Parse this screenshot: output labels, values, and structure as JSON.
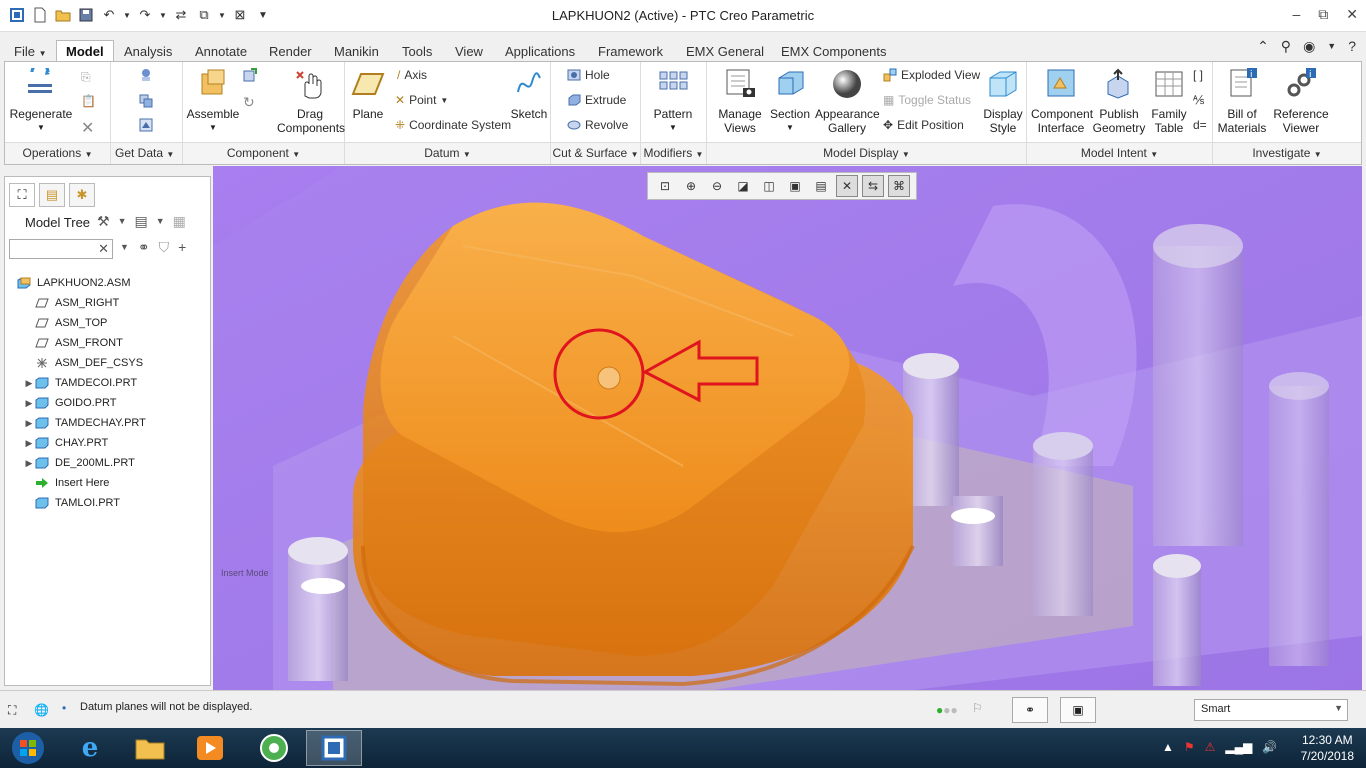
{
  "window": {
    "title": "LAPKHUON2 (Active) - PTC Creo Parametric"
  },
  "tabs": [
    "File",
    "Model",
    "Analysis",
    "Annotate",
    "Render",
    "Manikin",
    "Tools",
    "View",
    "Applications",
    "Framework",
    "EMX General",
    "EMX Components"
  ],
  "ribbon": {
    "regenerate": "Regenerate",
    "assemble": "Assemble",
    "drag_components": "Drag Components",
    "plane": "Plane",
    "axis": "Axis",
    "point": "Point",
    "coordinate_system": "Coordinate System",
    "sketch": "Sketch",
    "hole": "Hole",
    "extrude": "Extrude",
    "revolve": "Revolve",
    "pattern": "Pattern",
    "manage_views": "Manage Views",
    "section": "Section",
    "appearance_gallery": "Appearance Gallery",
    "exploded_view": "Exploded View",
    "toggle_status": "Toggle Status",
    "edit_position": "Edit Position",
    "display_style": "Display Style",
    "component_interface": "Component Interface",
    "publish_geometry": "Publish Geometry",
    "family_table": "Family Table",
    "bill_of_materials": "Bill of Materials",
    "reference_viewer": "Reference Viewer"
  },
  "groups": {
    "operations": "Operations",
    "get_data": "Get Data",
    "component": "Component",
    "datum": "Datum",
    "cut_surface": "Cut & Surface",
    "modifiers": "Modifiers",
    "model_display": "Model Display",
    "model_intent": "Model Intent",
    "investigate": "Investigate"
  },
  "model_tree": {
    "header": "Model Tree",
    "nodes": [
      {
        "label": "LAPKHUON2.ASM",
        "level": 0,
        "expandable": false,
        "type": "asm"
      },
      {
        "label": "ASM_RIGHT",
        "level": 1,
        "expandable": false,
        "type": "plane"
      },
      {
        "label": "ASM_TOP",
        "level": 1,
        "expandable": false,
        "type": "plane"
      },
      {
        "label": "ASM_FRONT",
        "level": 1,
        "expandable": false,
        "type": "plane"
      },
      {
        "label": "ASM_DEF_CSYS",
        "level": 1,
        "expandable": false,
        "type": "csys"
      },
      {
        "label": "TAMDECOI.PRT",
        "level": 1,
        "expandable": true,
        "type": "part"
      },
      {
        "label": "GOIDO.PRT",
        "level": 1,
        "expandable": true,
        "type": "part"
      },
      {
        "label": "TAMDECHAY.PRT",
        "level": 1,
        "expandable": true,
        "type": "part"
      },
      {
        "label": "CHAY.PRT",
        "level": 1,
        "expandable": true,
        "type": "part"
      },
      {
        "label": "DE_200ML.PRT",
        "level": 1,
        "expandable": true,
        "type": "part"
      },
      {
        "label": "Insert Here",
        "level": 1,
        "expandable": false,
        "type": "insert"
      },
      {
        "label": "TAMLOI.PRT",
        "level": 1,
        "expandable": false,
        "type": "part"
      }
    ]
  },
  "viewport": {
    "insert_mode_text": "Insert Mode"
  },
  "status": {
    "message": "Datum planes will not be displayed.",
    "filter": "Smart"
  },
  "taskbar": {
    "time": "12:30 AM",
    "date": "7/20/2018"
  },
  "colors": {
    "part_orange": "#f0901c",
    "mold_purple": "#9a6fe0",
    "annotation_red": "#e0141e"
  }
}
